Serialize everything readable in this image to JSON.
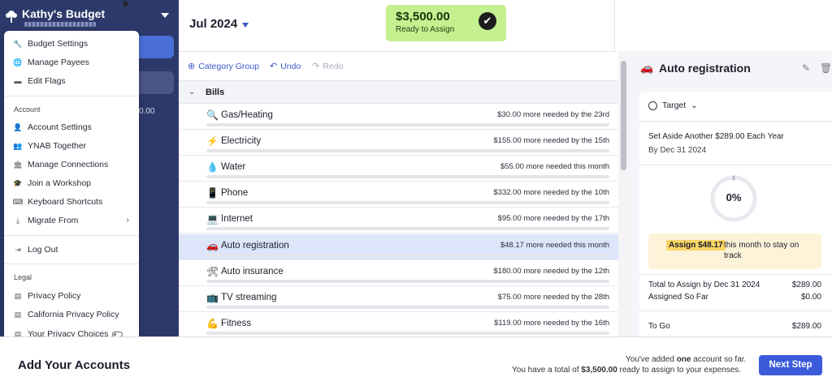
{
  "sidebar": {
    "budget_name": "Kathy's Budget",
    "partial_value": "0.00"
  },
  "menu": {
    "top_items": [
      {
        "label": "Budget Settings",
        "icon": "wrench-icon"
      },
      {
        "label": "Manage Payees",
        "icon": "globe-icon"
      },
      {
        "label": "Edit Flags",
        "icon": "flag-icon"
      }
    ],
    "account_section": "Account",
    "account_items": [
      {
        "label": "Account Settings",
        "icon": "person-icon"
      },
      {
        "label": "YNAB Together",
        "icon": "people-icon"
      },
      {
        "label": "Manage Connections",
        "icon": "bank-icon"
      },
      {
        "label": "Join a Workshop",
        "icon": "graduation-cap-icon"
      },
      {
        "label": "Keyboard Shortcuts",
        "icon": "keyboard-icon"
      },
      {
        "label": "Migrate From",
        "icon": "download-icon"
      }
    ],
    "logout": "Log Out",
    "legal_section": "Legal",
    "legal_items": [
      {
        "label": "Privacy Policy",
        "icon": "document-icon"
      },
      {
        "label": "California Privacy Policy",
        "icon": "document-icon"
      },
      {
        "label": "Your Privacy Choices",
        "icon": "document-icon"
      }
    ]
  },
  "header": {
    "month": "Jul 2024",
    "ready_amount": "$3,500.00",
    "ready_label": "Ready to Assign"
  },
  "toolbar": {
    "category_group": "Category Group",
    "undo": "Undo",
    "redo": "Redo"
  },
  "table": {
    "group_name": "Bills",
    "categories": [
      {
        "name": "Gas/Heating",
        "emoji": "🔍",
        "need": "$30.00 more needed by the 23rd"
      },
      {
        "name": "Electricity",
        "emoji": "⚡",
        "need": "$155.00 more needed by the 15th"
      },
      {
        "name": "Water",
        "emoji": "💧",
        "need": "$55.00 more needed this month"
      },
      {
        "name": "Phone",
        "emoji": "📱",
        "need": "$332.00 more needed by the 10th"
      },
      {
        "name": "Internet",
        "emoji": "💻",
        "need": "$95.00 more needed by the 17th"
      },
      {
        "name": "Auto registration",
        "emoji": "🚗",
        "need": "$48.17 more needed this month"
      },
      {
        "name": "Auto insurance",
        "emoji": "🛠",
        "need": "$180.00 more needed by the 12th"
      },
      {
        "name": "TV streaming",
        "emoji": "📺",
        "need": "$75.00 more needed by the 28th"
      },
      {
        "name": "Fitness",
        "emoji": "💪",
        "need": "$119.00 more needed by the 16th"
      }
    ],
    "selected_index": 5
  },
  "inspector": {
    "emoji": "🚗",
    "title": "Auto registration",
    "target_label": "Target",
    "target_desc": "Set Aside Another $289.00 Each Year",
    "target_by": "By Dec 31 2024",
    "progress_pct": "0%",
    "progress_fraction": 0,
    "assign_pill": "Assign $48.17",
    "assign_rest_1": "this month to stay on",
    "assign_rest_2": "track",
    "total_label": "Total to Assign by Dec 31 2024",
    "total_value": "$289.00",
    "assigned_label": "Assigned So Far",
    "assigned_value": "$0.00",
    "togo_label": "To Go",
    "togo_value": "$289.00"
  },
  "bottom": {
    "title": "Add Your Accounts",
    "line1_prefix": "You've added ",
    "line1_bold": "one",
    "line1_suffix": " account so far.",
    "line2_prefix": "You have a total of ",
    "line2_bold": "$3,500.00",
    "line2_suffix": " ready to assign to your expenses.",
    "next_button": "Next Step"
  },
  "colors": {
    "sidebar": "#2c396a",
    "accent": "#3b5bdb",
    "ready_bg": "#c4f08f",
    "selected_row": "#dde5fb",
    "assign_pill": "#f8d565"
  }
}
